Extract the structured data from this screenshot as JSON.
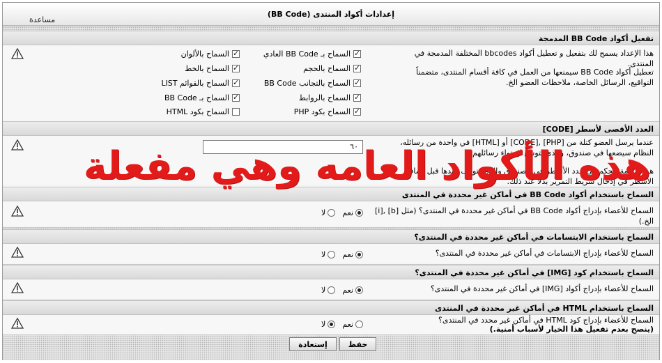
{
  "header": {
    "title": "إعدادات أكواد المنتدى (BB Code)",
    "help_label": "مساعدة"
  },
  "sections": {
    "bbcode": {
      "title": "تفعيل أكواد BB Code المدمجة",
      "desc1": "هذا الإعداد يسمح لك بتفعيل و تعطيل أكواد bbcodes المختلفة المدمجة في المنتدى.",
      "desc2": "تعطيل أكواد BB Code سيمنعها من العمل في كافة أقسام المنتدى، متضمناً التواقيع، الرسائل الخاصة، ملاحظات العضو الخ."
    },
    "code_lines": {
      "title": "العدد الأقصى لأسطر [CODE]",
      "desc1": "عندما يرسل العضو كتلة من [PHP] ,[CODE] أو [HTML] في واحدة من رسائله، النظام سيضعها في صندوق، والذي يتوسع لإحتواء رسائلهم.",
      "desc2": "هذه القيمة تتحكم في عدد الأسطر في الصندوق والذي يتوقف عندها قبل إضافة الأسطر في إدخال شريط التمرير بدلاً عند ذلك.",
      "value": "٦٠"
    },
    "allow_bbcode": {
      "title": "السماح باستخدام أكواد BB Code في أماكن غير محددة في المنتدى",
      "desc": "السماح للأعضاء بإدراج أكواد BB Code في أماكن غير محددة في المنتدى؟ (مثل [b] ,[i] الخ.)"
    },
    "allow_smilies": {
      "title": "السماح باستخدام الابتسامات في أماكن غير محددة في المنتدى؟",
      "desc": "السماح للأعضاء بإدراج الابتسامات في أماكن غير محددة في المنتدى؟"
    },
    "allow_img": {
      "title": "السماح باستخدام كود [IMG] في أماكن غير محددة في المنتدى؟",
      "desc": "السماح للأعضاء بإدراج أكواد [IMG] في أماكن غير محددة في المنتدى؟"
    },
    "allow_html": {
      "title": "السماح باستخدام HTML في أماكن غير محددة في المنتدى",
      "desc1": "السماح للأعضاء بإدراج كود HTML في أماكن غير محدد في المنتدى؟",
      "desc2": "(ينصح بعدم تفعيل هذا الخيار لأسباب أمنية.)"
    }
  },
  "checkboxes": {
    "basic": "السماح بـ BB Code العادي",
    "colors": "السماح بالألوان",
    "size": "السماح بالحجم",
    "font": "السماح بالخط",
    "align": "السماح بالتجانب BB Code",
    "list": "السماح بالقوائم LIST",
    "links": "السماح بالروابط",
    "bbcode": "السماح بـ BB Code",
    "php": "السماح بكود PHP",
    "html": "السماح بكود HTML"
  },
  "checked": {
    "basic": true,
    "colors": true,
    "size": true,
    "font": true,
    "align": true,
    "list": true,
    "links": true,
    "bbcode": true,
    "php": true,
    "html": false
  },
  "radio_labels": {
    "yes": "نعم",
    "no": "لا"
  },
  "radio_values": {
    "allow_bbcode": "yes",
    "allow_smilies": "yes",
    "allow_img": "yes",
    "allow_html": "no"
  },
  "buttons": {
    "save": "حفظ",
    "reset": "إستعادة"
  },
  "overlay_text": "هذه الأكواد العامه وهي مفعلة",
  "colors": {
    "overlay": "#e31a1a",
    "section_bg": "#e0e0e0",
    "row_bg": "#f7f7f7"
  },
  "icons": {
    "warning": "warning-triangle-icon"
  }
}
